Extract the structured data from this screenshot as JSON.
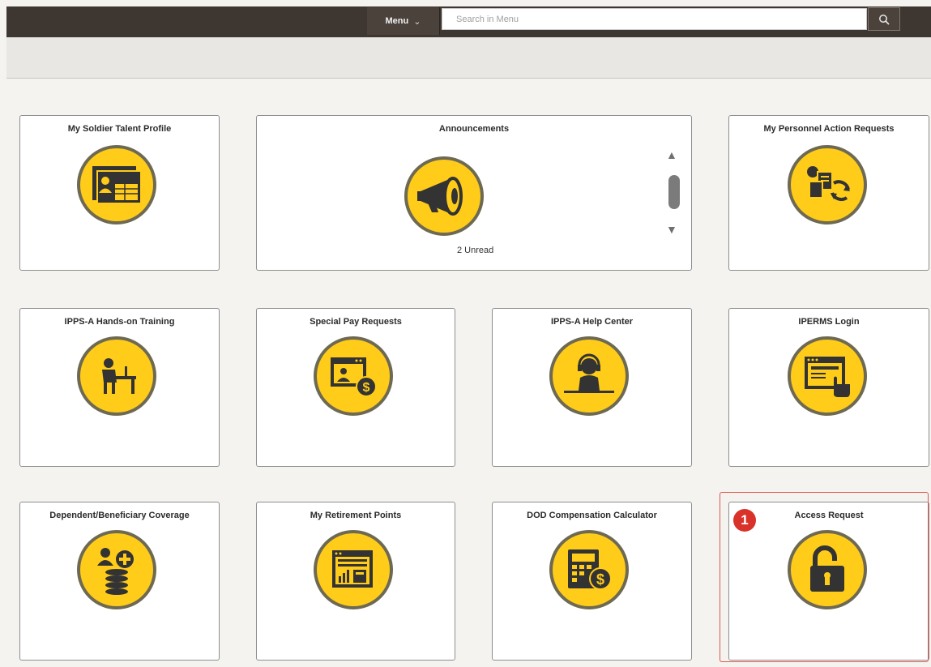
{
  "header": {
    "menu_label": "Menu",
    "search_placeholder": "Search in Menu"
  },
  "tiles": {
    "soldier_talent": {
      "title": "My Soldier Talent Profile"
    },
    "announcements": {
      "title": "Announcements",
      "unread_text": "2 Unread"
    },
    "personnel_action": {
      "title": "My Personnel Action Requests"
    },
    "hands_on": {
      "title": "IPPS-A Hands-on Training"
    },
    "special_pay": {
      "title": "Special Pay Requests"
    },
    "help_center": {
      "title": "IPPS-A Help Center"
    },
    "iperms": {
      "title": "IPERMS Login"
    },
    "dependent": {
      "title": "Dependent/Beneficiary Coverage"
    },
    "retirement": {
      "title": "My Retirement Points"
    },
    "dod_comp": {
      "title": "DOD Compensation Calculator"
    },
    "access_request": {
      "title": "Access Request"
    }
  },
  "annotation": {
    "step_number": "1"
  },
  "colors": {
    "topbar": "#3e3630",
    "icon_fill": "#ffcc1a",
    "icon_ring": "#6e6952",
    "glyph": "#333333",
    "highlight": "#e0574f",
    "badge": "#d9322b"
  }
}
